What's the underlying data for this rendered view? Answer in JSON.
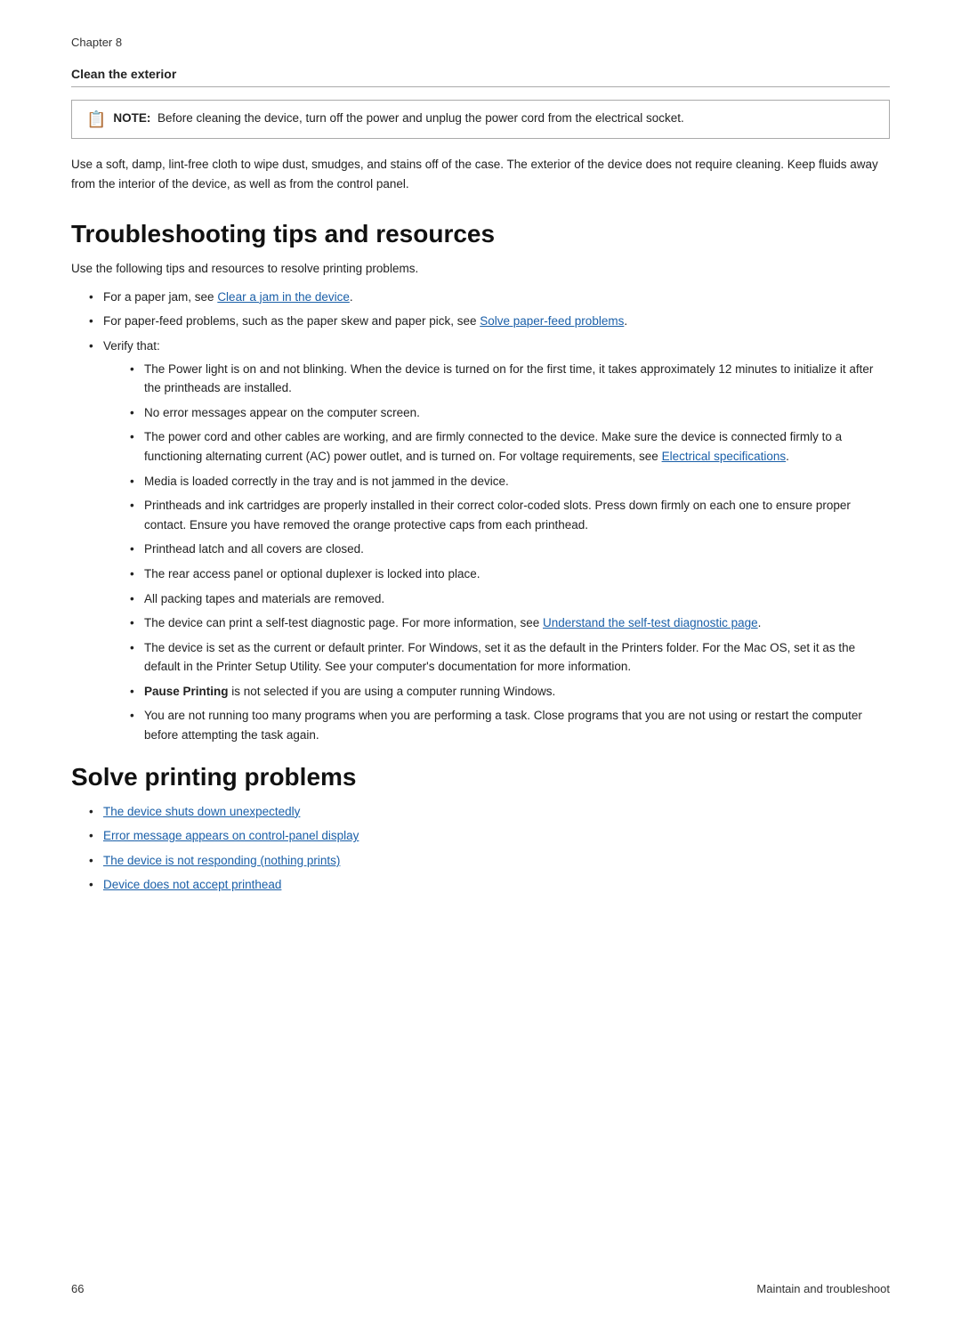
{
  "chapter": {
    "label": "Chapter 8"
  },
  "clean_exterior": {
    "heading": "Clean the exterior",
    "note_label": "NOTE:",
    "note_text": "Before cleaning the device, turn off the power and unplug the power cord from the electrical socket.",
    "body_text": "Use a soft, damp, lint-free cloth to wipe dust, smudges, and stains off of the case. The exterior of the device does not require cleaning. Keep fluids away from the interior of the device, as well as from the control panel."
  },
  "troubleshooting": {
    "heading": "Troubleshooting tips and resources",
    "intro": "Use the following tips and resources to resolve printing problems.",
    "items": [
      {
        "text": "For a paper jam, see ",
        "link_text": "Clear a jam in the device",
        "link_after": ""
      },
      {
        "text": "For paper-feed problems, such as the paper skew and paper pick, see ",
        "link_text": "Solve paper-feed problems",
        "link_after": ""
      },
      {
        "text": "Verify that:",
        "sub_items": [
          "The Power light is on and not blinking. When the device is turned on for the first time, it takes approximately 12 minutes to initialize it after the printheads are installed.",
          "No error messages appear on the computer screen.",
          "The power cord and other cables are working, and are firmly connected to the device. Make sure the device is connected firmly to a functioning alternating current (AC) power outlet, and is turned on. For voltage requirements, see [Electrical specifications].",
          "Media is loaded correctly in the tray and is not jammed in the device.",
          "Printheads and ink cartridges are properly installed in their correct color-coded slots. Press down firmly on each one to ensure proper contact. Ensure you have removed the orange protective caps from each printhead.",
          "Printhead latch and all covers are closed.",
          "The rear access panel or optional duplexer is locked into place.",
          "All packing tapes and materials are removed.",
          "The device can print a self-test diagnostic page. For more information, see [Understand the self-test diagnostic page].",
          "The device is set as the current or default printer. For Windows, set it as the default in the Printers folder. For the Mac OS, set it as the default in the Printer Setup Utility. See your computer's documentation for more information.",
          "[Pause Printing] is not selected if you are using a computer running Windows.",
          "You are not running too many programs when you are performing a task. Close programs that you are not using or restart the computer before attempting the task again."
        ],
        "sub_links": {
          "2": {
            "text": "Electrical specifications",
            "position": "inline"
          },
          "8": {
            "text": "Understand the self-test diagnostic page",
            "position": "inline"
          },
          "10": {
            "text": "Pause Printing",
            "position": "bold"
          }
        }
      }
    ]
  },
  "solve_printing": {
    "heading": "Solve printing problems",
    "links": [
      "The device shuts down unexpectedly",
      "Error message appears on control-panel display",
      "The device is not responding (nothing prints)",
      "Device does not accept printhead"
    ]
  },
  "footer": {
    "page_number": "66",
    "section_label": "Maintain and troubleshoot"
  }
}
